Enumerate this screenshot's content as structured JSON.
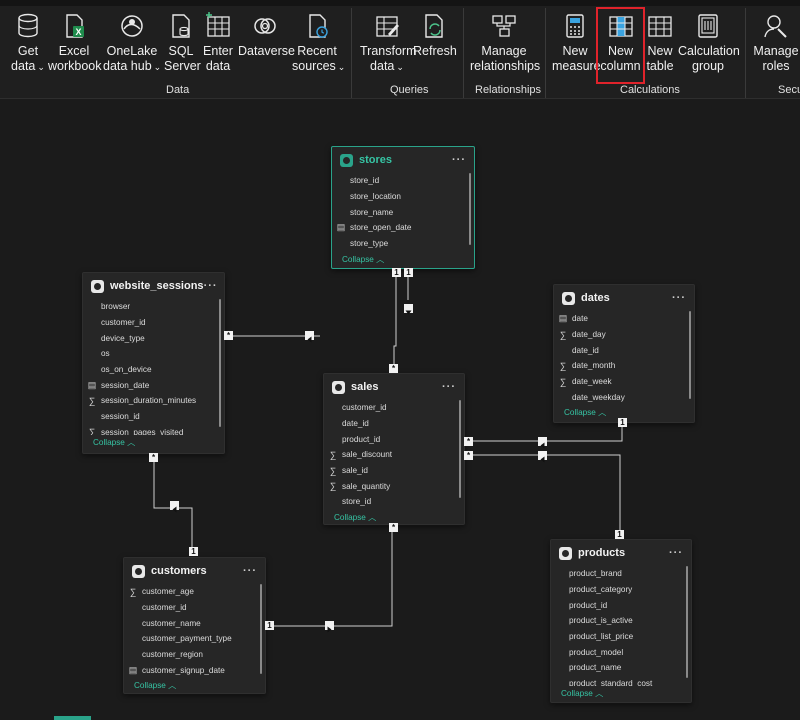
{
  "ribbon": {
    "buttons": [
      {
        "label1": "Get",
        "label2": "data",
        "chev": true
      },
      {
        "label1": "Excel",
        "label2": "workbook"
      },
      {
        "label1": "OneLake",
        "label2": "data hub",
        "chev": true
      },
      {
        "label1": "SQL",
        "label2": "Server"
      },
      {
        "label1": "Enter",
        "label2": "data"
      },
      {
        "label1": "Dataverse",
        "label2": ""
      },
      {
        "label1": "Recent",
        "label2": "sources",
        "chev": true
      },
      {
        "label1": "Transform",
        "label2": "data",
        "chev": true
      },
      {
        "label1": "Refresh",
        "label2": ""
      },
      {
        "label1": "Manage",
        "label2": "relationships"
      },
      {
        "label1": "New",
        "label2": "measure"
      },
      {
        "label1": "New",
        "label2": "column"
      },
      {
        "label1": "New",
        "label2": "table"
      },
      {
        "label1": "Calculation",
        "label2": "group"
      },
      {
        "label1": "Manage",
        "label2": "roles"
      }
    ],
    "groups": [
      "Data",
      "Queries",
      "Relationships",
      "Calculations",
      "Secur"
    ]
  },
  "tables": {
    "stores": {
      "name": "stores",
      "fields": [
        {
          "icon": "",
          "name": "store_id"
        },
        {
          "icon": "",
          "name": "store_location"
        },
        {
          "icon": "",
          "name": "store_name"
        },
        {
          "icon": "cal",
          "name": "store_open_date"
        },
        {
          "icon": "",
          "name": "store_type"
        }
      ],
      "collapse": "Collapse"
    },
    "website_sessions": {
      "name": "website_sessions",
      "fields": [
        {
          "icon": "",
          "name": "browser"
        },
        {
          "icon": "",
          "name": "customer_id"
        },
        {
          "icon": "",
          "name": "device_type"
        },
        {
          "icon": "",
          "name": "os"
        },
        {
          "icon": "",
          "name": "os_on_device"
        },
        {
          "icon": "cal",
          "name": "session_date"
        },
        {
          "icon": "sum",
          "name": "session_duration_minutes"
        },
        {
          "icon": "",
          "name": "session_id"
        },
        {
          "icon": "sum",
          "name": "session_pages_visited"
        }
      ],
      "collapse": "Collapse"
    },
    "dates": {
      "name": "dates",
      "fields": [
        {
          "icon": "cal",
          "name": "date"
        },
        {
          "icon": "sum",
          "name": "date_day"
        },
        {
          "icon": "",
          "name": "date_id"
        },
        {
          "icon": "sum",
          "name": "date_month"
        },
        {
          "icon": "sum",
          "name": "date_week"
        },
        {
          "icon": "",
          "name": "date_weekday"
        }
      ],
      "collapse": "Collapse"
    },
    "sales": {
      "name": "sales",
      "fields": [
        {
          "icon": "",
          "name": "customer_id"
        },
        {
          "icon": "",
          "name": "date_id"
        },
        {
          "icon": "",
          "name": "product_id"
        },
        {
          "icon": "sum",
          "name": "sale_discount"
        },
        {
          "icon": "sum",
          "name": "sale_id"
        },
        {
          "icon": "sum",
          "name": "sale_quantity"
        },
        {
          "icon": "",
          "name": "store_id"
        }
      ],
      "collapse": "Collapse"
    },
    "customers": {
      "name": "customers",
      "fields": [
        {
          "icon": "sum",
          "name": "customer_age"
        },
        {
          "icon": "",
          "name": "customer_id"
        },
        {
          "icon": "",
          "name": "customer_name"
        },
        {
          "icon": "",
          "name": "customer_payment_type"
        },
        {
          "icon": "",
          "name": "customer_region"
        },
        {
          "icon": "cal",
          "name": "customer_signup_date"
        }
      ],
      "collapse": "Collapse"
    },
    "products": {
      "name": "products",
      "fields": [
        {
          "icon": "",
          "name": "product_brand"
        },
        {
          "icon": "",
          "name": "product_category"
        },
        {
          "icon": "",
          "name": "product_id"
        },
        {
          "icon": "",
          "name": "product_is_active"
        },
        {
          "icon": "",
          "name": "product_list_price"
        },
        {
          "icon": "",
          "name": "product_model"
        },
        {
          "icon": "",
          "name": "product_name"
        },
        {
          "icon": "",
          "name": "product_standard_cost"
        }
      ],
      "collapse": "Collapse"
    }
  },
  "cardinality": {
    "one": "1",
    "many": "*"
  },
  "colors": {
    "accent": "#2aa38a",
    "highlight": "#e0232b"
  }
}
